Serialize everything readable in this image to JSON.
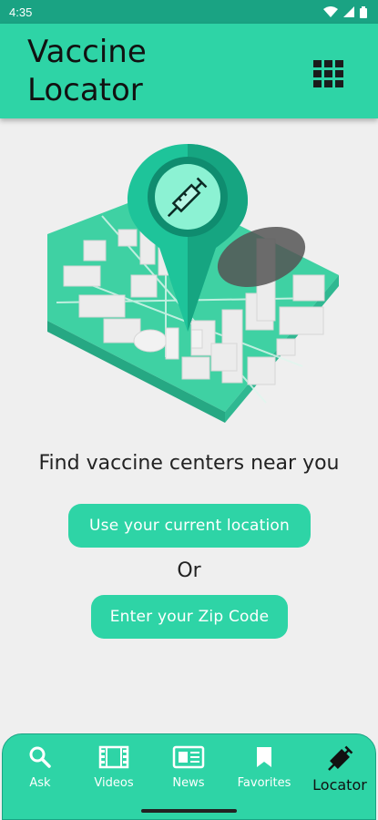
{
  "status_bar": {
    "time": "4:35"
  },
  "header": {
    "title": "Vaccine\nLocator",
    "menu_icon": "grid-icon"
  },
  "main": {
    "tagline": "Find vaccine centers near you",
    "current_location_button": "Use your current location",
    "or_text": "Or",
    "zip_button": "Enter your Zip Code"
  },
  "bottom_nav": {
    "items": [
      {
        "label": "Ask",
        "icon": "search-icon"
      },
      {
        "label": "Videos",
        "icon": "film-icon"
      },
      {
        "label": "News",
        "icon": "newspaper-icon"
      },
      {
        "label": "Favorites",
        "icon": "bookmark-icon"
      },
      {
        "label": "Locator",
        "icon": "syringe-icon",
        "active": true
      }
    ]
  },
  "colors": {
    "accent": "#2ed4a6",
    "status_bar": "#1aa383",
    "background": "#efefef"
  }
}
